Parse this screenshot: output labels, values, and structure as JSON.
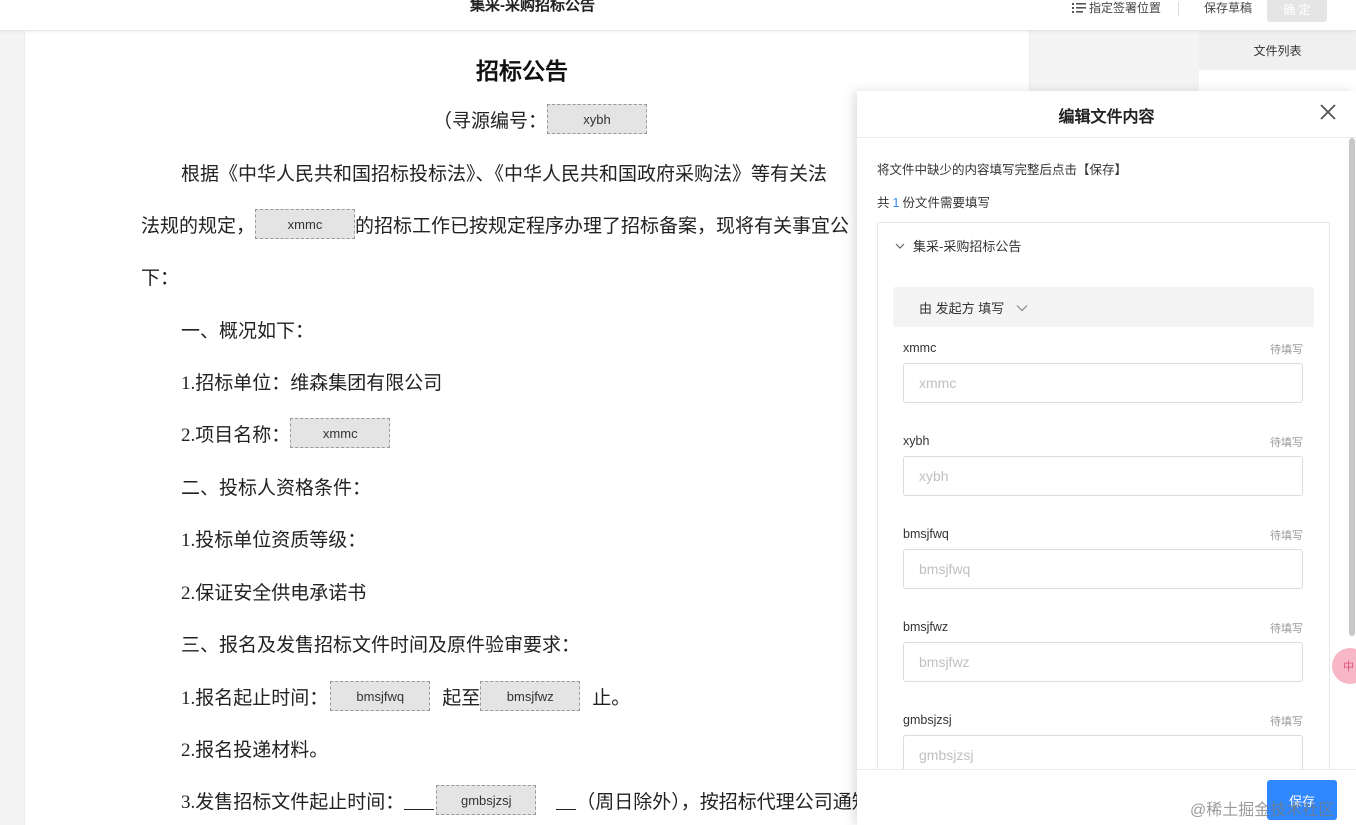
{
  "topbar": {
    "title": "集采-采购招标公告",
    "sign_position": "指定签署位置",
    "save_draft": "保存草稿",
    "confirm": "确 定"
  },
  "document": {
    "title": "招标公告",
    "l1_a": "（寻源编号：",
    "f_xybh": "xybh",
    "l2": "根据《中华人民共和国招标投标法》、《中华人民共和国政府采购法》等有关法",
    "l3_a": "法规的规定，",
    "f_xmmc1": "xmmc",
    "l3_b": "的招标工作已按规定程序办理了招标备案，现将有关事宜公",
    "l4": "下：",
    "l5": "一、概况如下：",
    "l6": "1.招标单位：维森集团有限公司",
    "l7_a": "2.项目名称：",
    "f_xmmc2": "xmmc",
    "l8": "二、投标人资格条件：",
    "l9": "1.投标单位资质等级：",
    "l10": "2.保证安全供电承诺书",
    "l11": "三、报名及发售招标文件时间及原件验审要求：",
    "l12_a": "1.报名起止时间：",
    "f_bmsjfwq": "bmsjfwq",
    "l12_b": "起至",
    "f_bmsjfwz": "bmsjfwz",
    "l12_c": "止。",
    "l13": "2.报名投递材料。",
    "l14_a": "3.发售招标文件起止时间：",
    "f_gmbsjzsj": "gmbsjzsj",
    "l14_b": "（周日除外），按招标代理公司通知"
  },
  "file_list": {
    "tab": "文件列表"
  },
  "panel": {
    "title": "编辑文件内容",
    "hint": "将文件中缺少的内容填写完整后点击【保存】",
    "count_prefix": "共",
    "count_num": "1",
    "count_suffix": "份文件需要填写",
    "file_name": "集采-采购招标公告",
    "fill_by": "由 发起方 填写",
    "fields": [
      {
        "label": "xmmc",
        "status": "待填写",
        "placeholder": "xmmc"
      },
      {
        "label": "xybh",
        "status": "待填写",
        "placeholder": "xybh"
      },
      {
        "label": "bmsjfwq",
        "status": "待填写",
        "placeholder": "bmsjfwq"
      },
      {
        "label": "bmsjfwz",
        "status": "待填写",
        "placeholder": "bmsjfwz"
      },
      {
        "label": "gmbsjzsj",
        "status": "待填写",
        "placeholder": "gmbsjzsj"
      }
    ],
    "save": "保存"
  },
  "float_bubble": "中",
  "watermark": "@稀土掘金技术社区",
  "colors": {
    "primary": "#2f88ff",
    "field_bg": "#e4e4e4"
  }
}
